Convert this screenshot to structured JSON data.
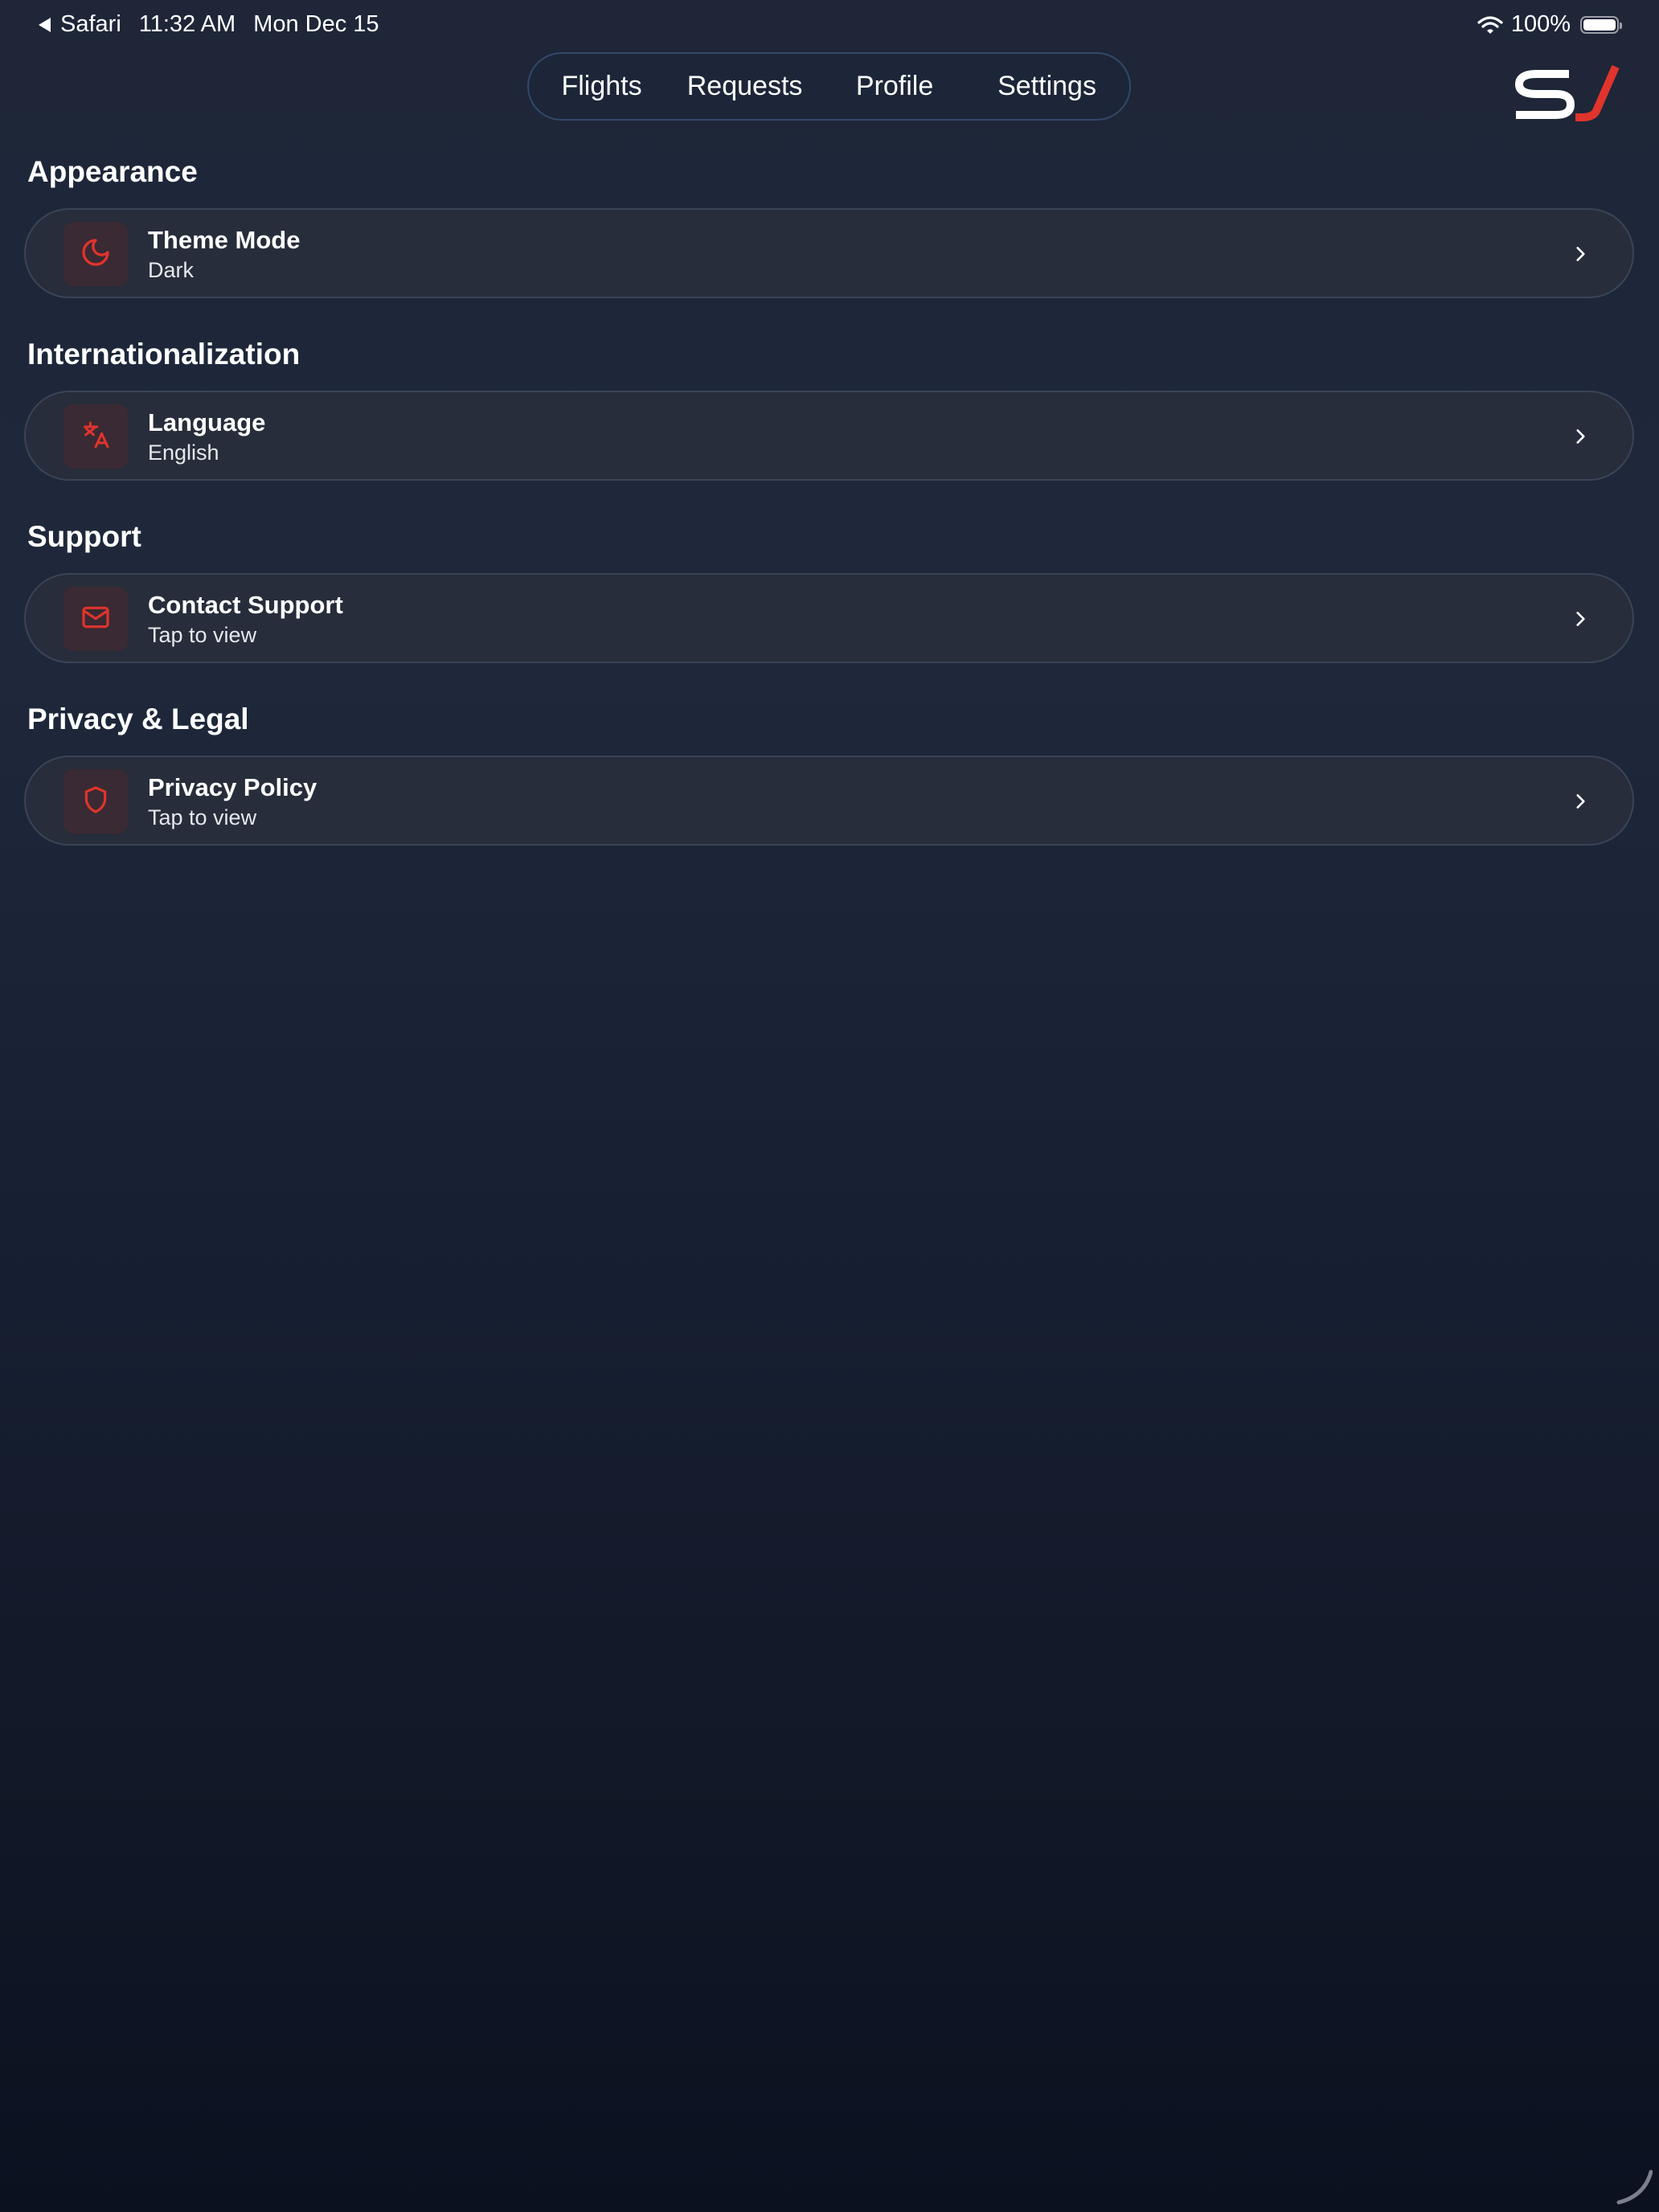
{
  "status_bar": {
    "back_app": "Safari",
    "time": "11:32 AM",
    "date": "Mon Dec 15",
    "battery_text": "100%",
    "battery_level": 1.0
  },
  "nav": {
    "tabs": [
      {
        "label": "Flights",
        "active": false
      },
      {
        "label": "Requests",
        "active": false
      },
      {
        "label": "Profile",
        "active": false
      },
      {
        "label": "Settings",
        "active": true
      }
    ],
    "active_color": "#2fa8ee"
  },
  "logo": {
    "text": "SJ",
    "colors": [
      "#ffffff",
      "#e0342c"
    ]
  },
  "sections": [
    {
      "heading": "Appearance",
      "item": {
        "title": "Theme Mode",
        "subtitle": "Dark",
        "icon": "moon-icon"
      }
    },
    {
      "heading": "Internationalization",
      "item": {
        "title": "Language",
        "subtitle": "English",
        "icon": "translate-icon"
      }
    },
    {
      "heading": "Support",
      "item": {
        "title": "Contact Support",
        "subtitle": "Tap to view",
        "icon": "mail-icon"
      }
    },
    {
      "heading": "Privacy & Legal",
      "item": {
        "title": "Privacy Policy",
        "subtitle": "Tap to view",
        "icon": "shield-icon"
      }
    }
  ],
  "accent_color": "#e0342c"
}
